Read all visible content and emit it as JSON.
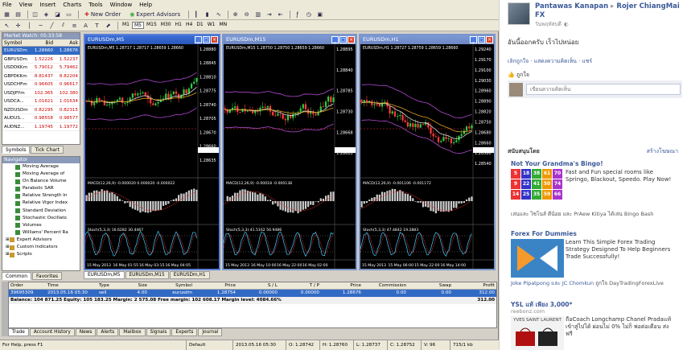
{
  "menu": [
    "File",
    "View",
    "Insert",
    "Charts",
    "Tools",
    "Window",
    "Help"
  ],
  "toolbar": {
    "new_order": "New Order",
    "expert_advisors": "Expert Advisors"
  },
  "timeframes": [
    "M1",
    "M5",
    "M15",
    "M30",
    "H1",
    "H4",
    "D1",
    "W1",
    "MN"
  ],
  "market_watch": {
    "title": "Market Watch: 05:33:58",
    "headers": [
      "Symbol",
      "Bid",
      "Ask"
    ],
    "rows": [
      {
        "symbol": "EURUSDm",
        "bid": "1.28660",
        "ask": "1.28676"
      },
      {
        "symbol": "GBPUSDm",
        "bid": "1.52226",
        "ask": "1.52237"
      },
      {
        "symbol": "USDDKKm",
        "bid": "5.79012",
        "ask": "5.79462"
      },
      {
        "symbol": "GBPDKKm",
        "bid": "8.81437",
        "ask": "8.82204"
      },
      {
        "symbol": "USDCHFm",
        "bid": "0.96605",
        "ask": "0.96617"
      },
      {
        "symbol": "USDJPYm",
        "bid": "102.365",
        "ask": "102.380"
      },
      {
        "symbol": "USDCA...",
        "bid": "1.01621",
        "ask": "1.01634"
      },
      {
        "symbol": "NZDUSDm",
        "bid": "0.82295",
        "ask": "0.82315"
      },
      {
        "symbol": "AUDUS...",
        "bid": "0.98558",
        "ask": "0.98577"
      },
      {
        "symbol": "AUDNZ...",
        "bid": "1.19745",
        "ask": "1.19772"
      }
    ],
    "tabs": [
      "Symbols",
      "Tick Chart"
    ]
  },
  "navigator": {
    "title": "Navigator",
    "items": [
      "Moving Average",
      "Moving Average of",
      "On Balance Volume",
      "Parabolic SAR",
      "Relative Strength In",
      "Relative Vigor Index",
      "Standard Deviation",
      "Stochastic Oscillato",
      "Volumes",
      "Williams' Percent Ra"
    ],
    "groups": [
      "Expert Advisors",
      "Custom Indicators",
      "Scripts"
    ],
    "tabs": [
      "Common",
      "Favorites"
    ]
  },
  "charts": [
    {
      "title": "EURUSDm,M5",
      "info": "EURUSDm,M5 1.28717 1.28717 1.28659 1.28660",
      "prices": [
        "1.28880",
        "1.28845",
        "1.28810",
        "1.28775",
        "1.28740",
        "1.28705",
        "1.28670",
        "1.28660",
        "1.28635"
      ],
      "macd": "MACD(12,26,9) -0.000020 0.000020 -0.000022",
      "stoch": "Stoch(5,3,3) 16.6282 30.4467",
      "times": [
        "15 May 2013",
        "16 May 01:55",
        "16 May 03:15",
        "16 May 04:05"
      ]
    },
    {
      "title": "EURUSDm,M15",
      "info": "EURUSDm,M15 1.28750 1.28750 1.28659 1.28660",
      "prices": [
        "1.28895",
        "1.28840",
        "1.28785",
        "1.28730",
        "1.28668",
        "1.28620"
      ],
      "macd": "MACD(12,26,9) -0.00018 -0.000138",
      "stoch": "Stoch(5,3,3) 41.5162 56.9486",
      "times": [
        "15 May 2013",
        "16 May 10:00",
        "16 May 22:00",
        "16 May 02:00"
      ]
    },
    {
      "title": "EURUSDm,H1",
      "info": "EURUSDm,H1 1.28727 1.28759 1.28659 1.28660",
      "prices": [
        "1.29240",
        "1.29170",
        "1.29100",
        "1.29030",
        "1.28960",
        "1.28890",
        "1.28820",
        "1.28750",
        "1.28680",
        "1.28660",
        "1.28580",
        "1.28540"
      ],
      "macd": "MACD(12,26,9) -0.001106 -0.001172",
      "stoch": "Stoch(5,3,3) 47.4842 19.2883",
      "times": [
        "15 May 2013",
        "15 May 06:00",
        "15 May 22:00",
        "16 May 14:00"
      ]
    }
  ],
  "chart_tabs": [
    "EURUSDm,M5",
    "EURUSDm,M15",
    "EURUSDm,H1"
  ],
  "terminal": {
    "headers": [
      "Order",
      "Time",
      "Type",
      "Size",
      "Symbol",
      "Price",
      "S / L",
      "T / P",
      "Price",
      "Commission",
      "Swap",
      "Profit"
    ],
    "rows": [
      [
        "39695309",
        "2013.05.16 05:30",
        "sell",
        "4.00",
        "eurusdm",
        "1.28754",
        "0.00000",
        "0.00000",
        "1.28676",
        "0.00",
        "0.00",
        "312.00"
      ]
    ],
    "balance": "Balance: 104 871.25  Equity: 105 183.25  Margin: 2 575.08  Free margin: 102 608.17  Margin level: 4084.66%",
    "balance_profit": "312.00",
    "tabs": [
      "Trade",
      "Account History",
      "News",
      "Alerts",
      "Mailbox",
      "Signals",
      "Experts",
      "Journal"
    ]
  },
  "status": {
    "help": "For Help, press F1",
    "profile": "Default",
    "datetime": "2013.05.16 05:30",
    "open": "O: 1.28742",
    "high": "H: 1.28760",
    "low": "L: 1.28737",
    "close": "C: 1.28752",
    "volume": "V: 96",
    "traffic": "715/1 kb"
  },
  "facebook": {
    "name": "Pantawas Kanapan",
    "arrow": "▸",
    "target": "Rojer ChiangMai FX",
    "time": "วันพฤหัสบดี",
    "post": "อันนี้ออกครับ เร็วไปหน่อย",
    "actions": "เลิกถูกใจ · แสดงความคิดเห็น · แชร์",
    "likes": "ถูกใจ",
    "comment_placeholder": "เขียนความคิดเห็น",
    "sponsored": "สนับสนุนโดย",
    "create_ad": "สร้างโฆษณา",
    "ads": [
      {
        "title": "Not Your Grandma's Bingo!",
        "body": "Fast and Fun special rooms like Springo, Blackout, Speedo. Play Now!",
        "social": "เล่นและ ไซโนส์ ดีน้อย และ PrAew Kitiya ได้เล่น Bingo Bash",
        "numbers": [
          "5",
          "18",
          "38",
          "61",
          "70",
          "9",
          "22",
          "41",
          "50",
          "74",
          "14",
          "25",
          "35",
          "59",
          "66"
        ]
      },
      {
        "title": "Forex For Dummies",
        "body": "Learn This Simple Forex Trading Strategy Designed To Help Beginners Trade Successfully!",
        "social_name": "Joke Pipatpong และ JC Chomkun",
        "social_tail": " ถูกใจ DayTradingForexLive"
      },
      {
        "title": "YSL แท้ เพียง 3,000*",
        "sub": "reebonz.com",
        "body": "ถือCoach Longchamp Chanel Pradaแท้เข้าสู่ไปได้ ผ่อนไม่ 0% ไม่ก็ พ่อต่อเดือน ส่งฟรี",
        "brand": "YVES SAINT LAURENT"
      }
    ]
  }
}
